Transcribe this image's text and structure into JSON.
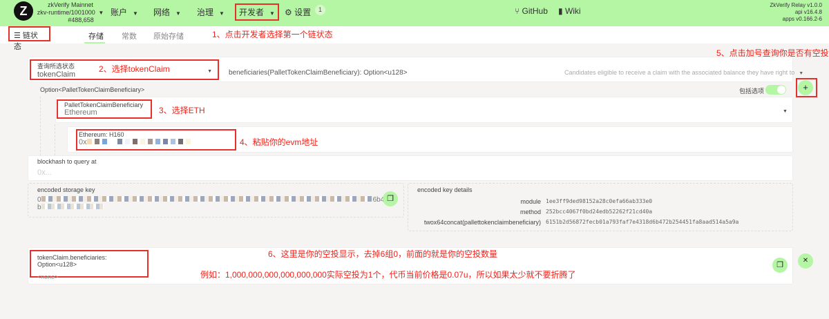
{
  "header": {
    "logo": "Z",
    "chain_name": "zkVerify Mainnet",
    "runtime": "zkv-runtime/1001000",
    "block": "#488,658",
    "menu": [
      "账户",
      "网络",
      "治理",
      "开发者"
    ],
    "settings": "设置",
    "settings_badge": "1",
    "github": "GitHub",
    "wiki": "Wiki",
    "version": [
      "ZkVerify Relay v1.0.0",
      "api v16.4.8",
      "apps v0.166.2-6"
    ]
  },
  "subnav": {
    "section": "链状态",
    "tabs": [
      "存储",
      "常数",
      "原始存储"
    ]
  },
  "query": {
    "label": "查询所选状态",
    "module": "tokenClaim",
    "method": "beneficiaries(PalletTokenClaimBeneficiary): Option<u128>",
    "description": "Candidates eligible to receive a claim with the associated balance they have right to"
  },
  "option": {
    "type": "Option<PalletTokenClaimBeneficiary>",
    "include_label": "包括选项",
    "include_on": true
  },
  "beneficiary": {
    "label": "PalletTokenClaimBeneficiary",
    "value": "Ethereum"
  },
  "eth": {
    "label": "Ethereum: H160",
    "value_prefix": "0x"
  },
  "blockhash": {
    "label": "blockhash to query at",
    "placeholder": "0x..."
  },
  "storage_key": {
    "label": "encoded storage key",
    "line1_prefix": "0",
    "line1_suffix": "6b47",
    "line2_prefix": "b"
  },
  "key_details": {
    "label": "encoded key details",
    "rows": [
      {
        "k": "module",
        "v": "1ee3ff9ded98152a28c0efa66ab333e0"
      },
      {
        "k": "method",
        "v": "252bcc4067f0bd24edb52262f21cd40a"
      },
      {
        "k": "twox64concat(pallettokenclaimbeneficiary)",
        "v": "6151b2d56872fecb01a793faf7e4318d6b472b254451fa8aad514a5a9a"
      }
    ]
  },
  "result": {
    "label": "tokenClaim.beneficiaries: Option<u128>",
    "value": "<none>"
  },
  "annotations": {
    "a1": "1、点击开发者选择第一个链状态",
    "a2": "2、选择tokenClaim",
    "a3": "3、选择ETH",
    "a4": "4、粘贴你的evm地址",
    "a5": "5、点击加号查询你是否有空投",
    "a6": "6、这里是你的空投显示，去掉6组0，前面的就是你的空投数量",
    "a7": "例如：1,000,000,000,000,000,000实际空投为1个，代币当前价格是0.07u，所以如果太少就不要折腾了"
  },
  "icons": {
    "plus": "+",
    "close": "✕",
    "copy": "❐"
  }
}
